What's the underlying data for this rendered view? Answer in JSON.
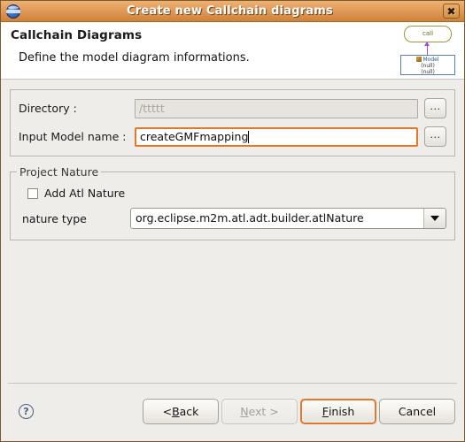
{
  "window": {
    "title": "Create new Callchain diagrams",
    "icon": "eclipse-globe-icon",
    "close_label": "✖"
  },
  "header": {
    "title": "Callchain Diagrams",
    "description": "Define the model diagram informations.",
    "graphic": {
      "call_node_label": "call",
      "model_node_title": "Model",
      "model_node_line2": "(null)",
      "model_node_line3": "(null)"
    }
  },
  "form": {
    "directory": {
      "label": "Directory :",
      "value": "/ttttt",
      "enabled": false,
      "browse_label": "..."
    },
    "input_model_name": {
      "label": "Input Model name :",
      "value": "createGMFmapping",
      "enabled": true,
      "browse_label": "..."
    }
  },
  "project_nature": {
    "group_title": "Project Nature",
    "add_atl_nature": {
      "label": "Add Atl Nature",
      "checked": false
    },
    "nature_type": {
      "label": "nature type",
      "value": "org.eclipse.m2m.atl.adt.builder.atlNature",
      "options": [
        "org.eclipse.m2m.atl.adt.builder.atlNature"
      ]
    }
  },
  "footer": {
    "help_label": "?",
    "buttons": {
      "back": {
        "prefix": "< ",
        "mnemonic": "B",
        "rest": "ack",
        "enabled": true
      },
      "next": {
        "prefix": "",
        "mnemonic": "N",
        "rest": "ext >",
        "enabled": false
      },
      "finish": {
        "prefix": "",
        "mnemonic": "F",
        "rest": "inish",
        "enabled": true,
        "default": true
      },
      "cancel": {
        "prefix": "",
        "mnemonic": "",
        "rest": "Cancel",
        "enabled": true
      }
    }
  },
  "colors": {
    "titlebar_orange": "#d9904c",
    "focus_orange": "#e2762a",
    "dialog_bg": "#efedea",
    "header_bg": "#ffffff"
  }
}
